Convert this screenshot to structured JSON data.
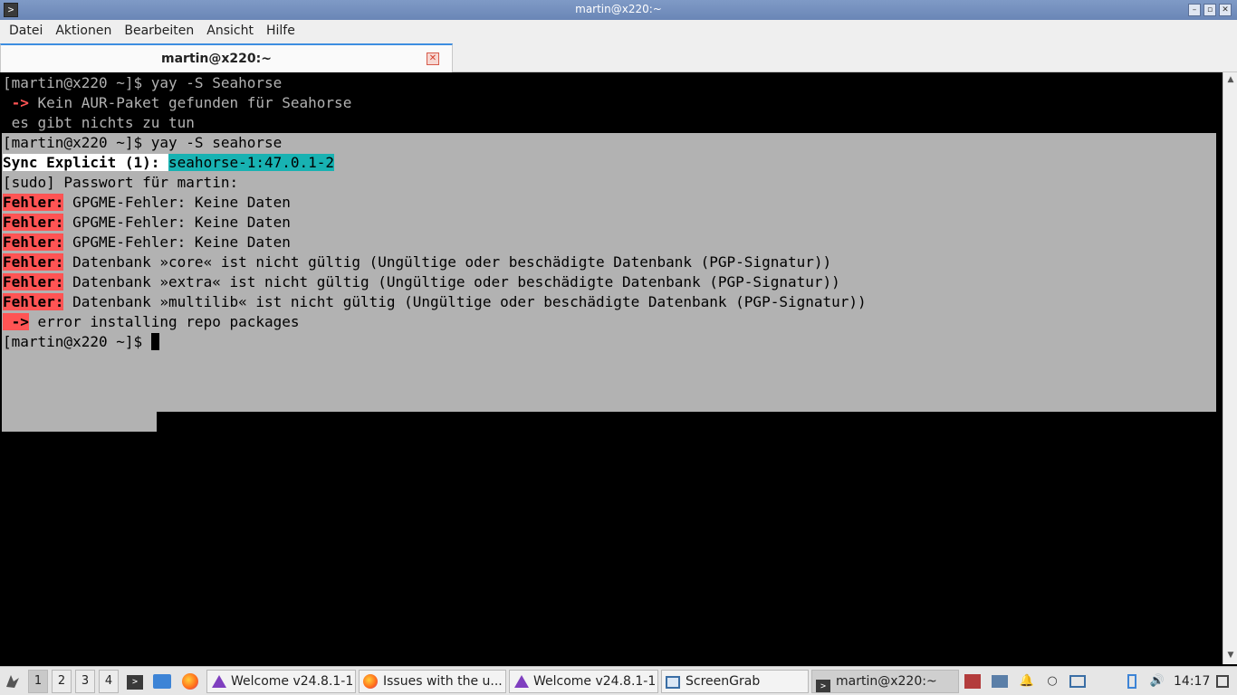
{
  "window": {
    "title": "martin@x220:~"
  },
  "menu": [
    "Datei",
    "Aktionen",
    "Bearbeiten",
    "Ansicht",
    "Hilfe"
  ],
  "tab": {
    "label": "martin@x220:~"
  },
  "terminal": {
    "lines": [
      {
        "prompt": "[martin@x220 ~]$ ",
        "cmd": "yay -S Seahorse"
      },
      {
        "arrow": " ->",
        "text": " Kein AUR-Paket gefunden für Seahorse"
      },
      {
        "text": " es gibt nichts zu tun"
      },
      {
        "prompt": "[martin@x220 ~]$ ",
        "cmd": "yay -S seahorse"
      },
      {
        "label": "Sync Explicit (1):",
        "pkg": "seahorse-1:47.0.1-2"
      },
      {
        "text": "[sudo] Passwort für martin:"
      },
      {
        "err": "Fehler:",
        "text": " GPGME-Fehler: Keine Daten"
      },
      {
        "err": "Fehler:",
        "text": " GPGME-Fehler: Keine Daten"
      },
      {
        "err": "Fehler:",
        "text": " GPGME-Fehler: Keine Daten"
      },
      {
        "err": "Fehler:",
        "text": " Datenbank »core« ist nicht gültig (Ungültige oder beschädigte Datenbank (PGP-Signatur))"
      },
      {
        "err": "Fehler:",
        "text": " Datenbank »extra« ist nicht gültig (Ungültige oder beschädigte Datenbank (PGP-Signatur))"
      },
      {
        "err": "Fehler:",
        "text": " Datenbank »multilib« ist nicht gültig (Ungültige oder beschädigte Datenbank (PGP-Signatur))"
      },
      {
        "arrow": " ->",
        "text": " error installing repo packages"
      },
      {
        "prompt": "[martin@x220 ~]$ "
      }
    ]
  },
  "taskbar": {
    "workspaces": [
      "1",
      "2",
      "3",
      "4"
    ],
    "active_workspace": "1",
    "tasks": [
      {
        "label": "Welcome v24.8.1-1",
        "icon": "endeavouros-icon"
      },
      {
        "label": "Issues with the u...",
        "icon": "firefox-icon"
      },
      {
        "label": "Welcome v24.8.1-1",
        "icon": "endeavouros-icon"
      },
      {
        "label": "ScreenGrab",
        "icon": "screengrab-icon"
      },
      {
        "label": "martin@x220:~",
        "icon": "terminal-icon"
      }
    ],
    "clock": "14:17"
  },
  "colors": {
    "error": "#ff5454",
    "package": "#18b2b2",
    "selection": "#b2b2b2"
  }
}
